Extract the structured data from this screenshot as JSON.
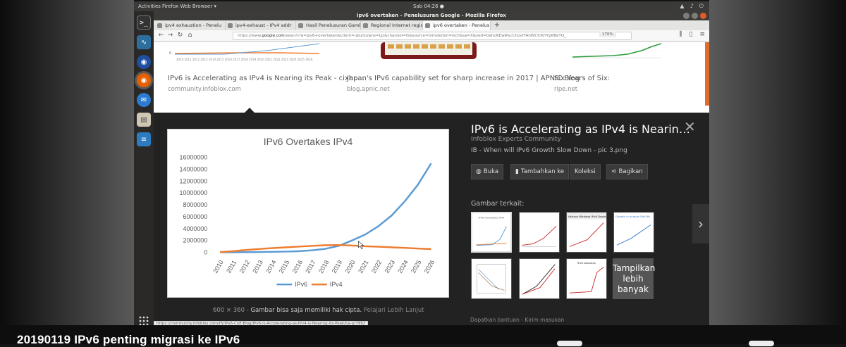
{
  "desktop": {
    "activities": "Activities",
    "app_menu": "Firefox Web Browser ▾",
    "clock": "Sab 04:26 ●"
  },
  "window": {
    "title": "ipv6 overtaken - Penelusuran Google - Mozilla Firefox"
  },
  "tabs": [
    {
      "label": "ipv4 exhaustion - Penelu"
    },
    {
      "label": "ipv4-exhaust - IPv4 addr"
    },
    {
      "label": "Hasil Penelusuran Gamb"
    },
    {
      "label": "Regional Internet regist"
    },
    {
      "label": "ipv6 overtaken - Penelus"
    }
  ],
  "url": {
    "prefix": "https://www.",
    "host": "google.com",
    "rest": "/search?q=ipv6+overtaken&client=ubuntu&hs=LJz&channel=fs&source=lnms&tbm=isch&sa=X&ved=0ahUKEwjPycChovfYAhWCfcKHYp6BeYQ_",
    "zoom": "170%"
  },
  "results": [
    {
      "title": "IPv6 is Accelerating as IPv4 is Nearing its Peak - cixhp...",
      "source": "community.infoblox.com"
    },
    {
      "title": "Japan's IPv6 capability set for sharp increase in 2017 | APNIC Blog",
      "source": "blog.apnic.net"
    },
    {
      "title": "Six Years of Six:",
      "source": "ripe.net"
    }
  ],
  "preview": {
    "title": "IPv6 is Accelerating as IPv4 is Nearin…",
    "site": "Infoblox Experts Community",
    "desc": "IB - When will IPv6 Growth Slow Down - pic 3.png",
    "size": "600 × 360",
    "sep": "-",
    "copyright": "Gambar bisa saja memiliki hak cipta.",
    "learn_more": "Pelajari Lebih Lanjut",
    "buttons": {
      "open": "Buka",
      "add": "Tambahkan ke",
      "collections": "Koleksi",
      "share": "Bagikan"
    },
    "related_label": "Gambar terkait:",
    "more_label": "Tampilkan lebih banyak",
    "help": "Dapatkan bantuan",
    "help_sep": "-",
    "feedback": "Kirim masukan"
  },
  "status_url": "https://community.infoblox.com/t5/IPv6-CoE-Blog/IPv6-is-Accelerating-as-IPv4-is-Nearing-its-Peak/ba-p/7992",
  "video_title": "20190119 IPv6 penting migrasi ke IPv6",
  "colors": {
    "ipv6": "#5b9bd5",
    "ipv4": "#ed7d31",
    "scroll_accent": "#e06c2c",
    "launcher": "#2b2927"
  },
  "icons": [
    "terminal-icon",
    "system-monitor-icon",
    "firefox-dev-icon",
    "firefox-icon",
    "thunderbird-icon",
    "files-icon",
    "writer-icon",
    "apps-grid-icon",
    "close-icon",
    "chevron-right-icon",
    "globe-icon",
    "bookmark-icon",
    "share-icon"
  ],
  "chart_data": {
    "type": "line",
    "title": "IPv6 Overtakes IPv4",
    "x": [
      "2010",
      "2011",
      "2012",
      "2013",
      "2014",
      "2015",
      "2016",
      "2017",
      "2018",
      "2019",
      "2020",
      "2021",
      "2022",
      "2023",
      "2024",
      "2025",
      "2026"
    ],
    "series": [
      {
        "name": "IPv6",
        "values": [
          10000,
          20000,
          40000,
          60000,
          90000,
          130000,
          200000,
          350000,
          600000,
          1100000,
          2000000,
          3000000,
          4400000,
          6200000,
          8600000,
          11400000,
          15000000
        ]
      },
      {
        "name": "IPv4",
        "values": [
          50000,
          200000,
          400000,
          580000,
          720000,
          850000,
          980000,
          1100000,
          1200000,
          1230000,
          1150000,
          1020000,
          950000,
          850000,
          750000,
          650000,
          550000
        ]
      }
    ],
    "yticks": [
      "0",
      "2000000",
      "4000000",
      "6000000",
      "8000000",
      "10000000",
      "12000000",
      "14000000",
      "16000000"
    ],
    "ylim": [
      0,
      16000000
    ],
    "legend_position": "bottom",
    "grid": false
  }
}
